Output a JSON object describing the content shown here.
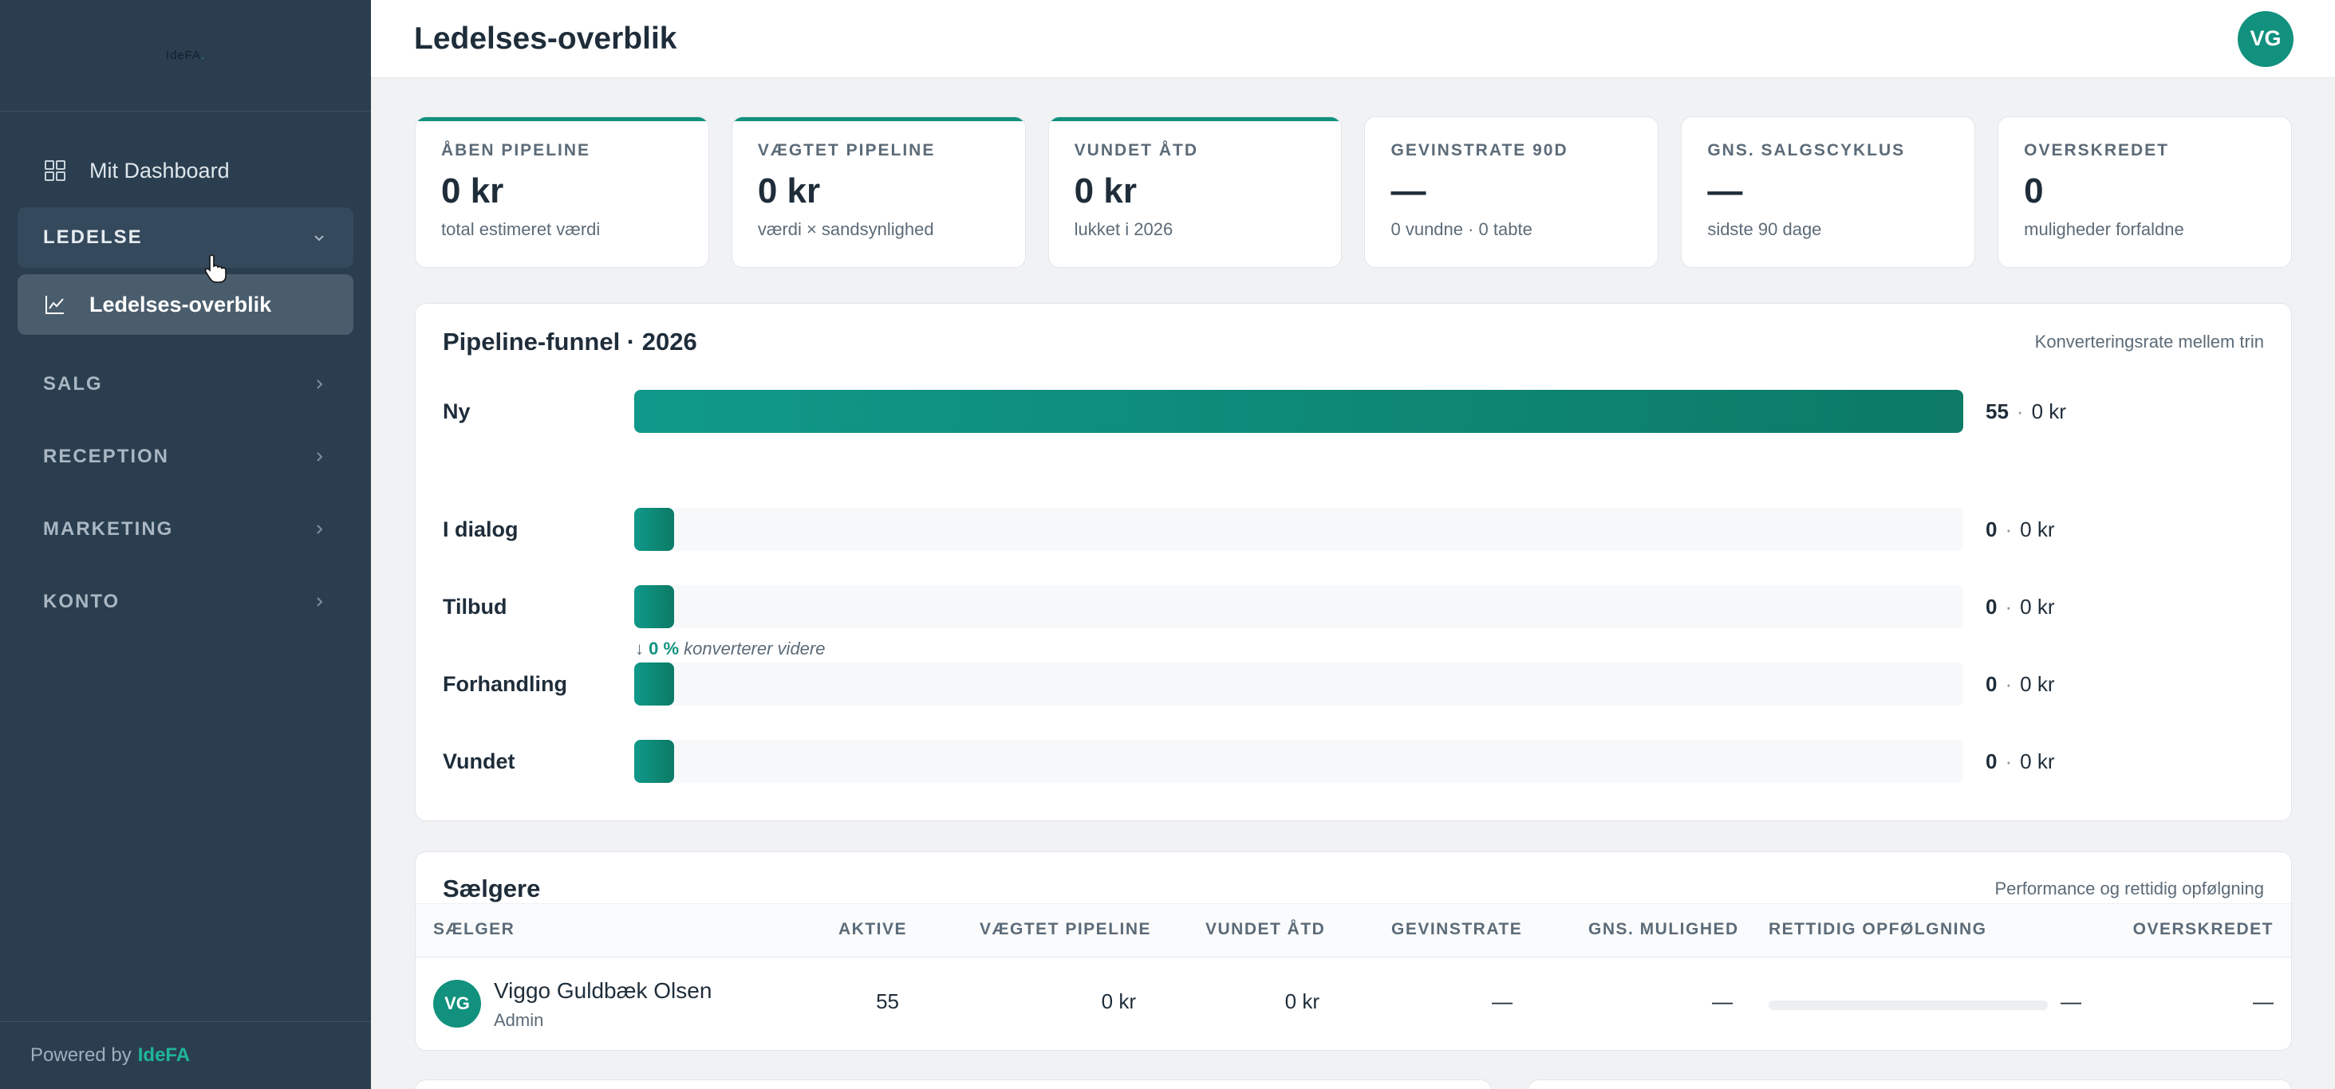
{
  "app": {
    "logo_text": "IdeFA",
    "logo_dot": "."
  },
  "sidebar": {
    "dashboard_label": "Mit Dashboard",
    "sections": [
      {
        "label": "LEDELSE",
        "open": true
      },
      {
        "label": "SALG"
      },
      {
        "label": "RECEPTION"
      },
      {
        "label": "MARKETING"
      },
      {
        "label": "KONTO"
      }
    ],
    "active_item_label": "Ledelses-overblik",
    "footer_prefix": "Powered by",
    "footer_brand": "IdeFA"
  },
  "header": {
    "title": "Ledelses-overblik",
    "avatar_initials": "VG"
  },
  "kpis": [
    {
      "label": "ÅBEN PIPELINE",
      "value": "0 kr",
      "sub": "total estimeret værdi",
      "accent": true
    },
    {
      "label": "VÆGTET PIPELINE",
      "value": "0 kr",
      "sub": "værdi × sandsynlighed",
      "accent": true
    },
    {
      "label": "VUNDET ÅTD",
      "value": "0 kr",
      "sub": "lukket i 2026",
      "accent": true
    },
    {
      "label": "GEVINSTRATE 90D",
      "value": "—",
      "sub": "0 vundne · 0 tabte",
      "accent": false
    },
    {
      "label": "GNS. SALGSCYKLUS",
      "value": "—",
      "sub": "sidste 90 dage",
      "accent": false
    },
    {
      "label": "OVERSKREDET",
      "value": "0",
      "sub": "muligheder forfaldne",
      "accent": false
    }
  ],
  "funnel": {
    "title": "Pipeline-funnel · 2026",
    "hint": "Konverteringsrate mellem trin",
    "conversion_percent": "0 %",
    "conversion_text": "konverterer videre",
    "max_count": 55,
    "separator": "·",
    "stages": [
      {
        "name": "Ny",
        "count": 55,
        "amount": "0 kr"
      },
      {
        "name": "I dialog",
        "count": 0,
        "amount": "0 kr"
      },
      {
        "name": "Tilbud",
        "count": 0,
        "amount": "0 kr"
      },
      {
        "name": "Forhandling",
        "count": 0,
        "amount": "0 kr"
      },
      {
        "name": "Vundet",
        "count": 0,
        "amount": "0 kr"
      }
    ]
  },
  "sellers": {
    "title": "Sælgere",
    "hint": "Performance og rettidig opfølgning",
    "columns": [
      "SÆLGER",
      "AKTIVE",
      "VÆGTET PIPELINE",
      "VUNDET ÅTD",
      "GEVINSTRATE",
      "GNS. MULIGHED",
      "RETTIDIG OPFØLGNING",
      "OVERSKREDET"
    ],
    "rows": [
      {
        "initials": "VG",
        "name": "Viggo Guldbæk Olsen",
        "role": "Admin",
        "active": "55",
        "weighted": "0 kr",
        "won": "0 kr",
        "winrate": "—",
        "avg": "—",
        "followup": "—",
        "followup_fraction": 0,
        "overdue": "—"
      }
    ]
  },
  "colors": {
    "accent": "#11917e",
    "sidebar": "#2a3e4f",
    "bar_start": "#10998a",
    "bar_end": "#0c7a66"
  }
}
